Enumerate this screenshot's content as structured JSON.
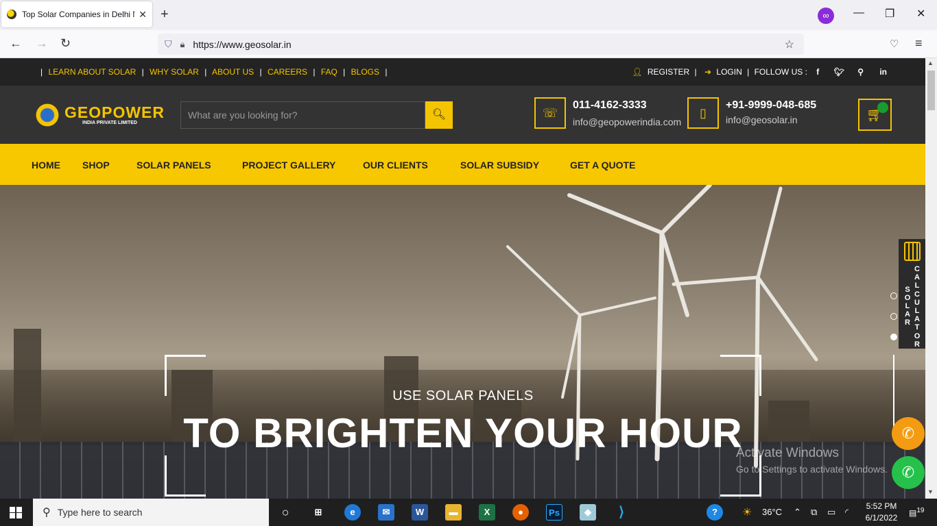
{
  "browser": {
    "tab_title": "Top Solar Companies in Delhi N",
    "url": "https://www.geosolar.in"
  },
  "topbar": {
    "links": [
      "LEARN ABOUT SOLAR",
      "WHY SOLAR",
      "ABOUT US",
      "CAREERS",
      "FAQ",
      "BLOGS"
    ],
    "register": "REGISTER",
    "login": "LOGIN",
    "follow": "FOLLOW US :"
  },
  "header": {
    "logo_word": "GEOPOWER",
    "logo_sub": "INDIA PRIVATE LIMITED",
    "search_placeholder": "What are you looking for?",
    "contact1": {
      "phone": "011-4162-3333",
      "email": "info@geopowerindia.com"
    },
    "contact2": {
      "phone": "+91-9999-048-685",
      "email": "info@geosolar.in"
    }
  },
  "menu": [
    "HOME",
    "SHOP",
    "SOLAR PANELS",
    "PROJECT GALLERY",
    "OUR CLIENTS",
    "SOLAR SUBSIDY",
    "GET A QUOTE"
  ],
  "hero": {
    "subtitle": "USE SOLAR PANELS",
    "title": "TO BRIGHTEN YOUR HOUR",
    "slides_active_index": 2
  },
  "calculator": {
    "label1": "SOLAR",
    "label2": "CALCULATOR"
  },
  "watermark": {
    "line1": "Activate Windows",
    "line2": "Go to Settings to activate Windows."
  },
  "taskbar": {
    "search_placeholder": "Type here to search",
    "weather": "36°C",
    "time": "5:52 PM",
    "date": "6/1/2022",
    "notifications": "19"
  },
  "colors": {
    "brand_yellow": "#f7c800",
    "dark": "#333333"
  }
}
